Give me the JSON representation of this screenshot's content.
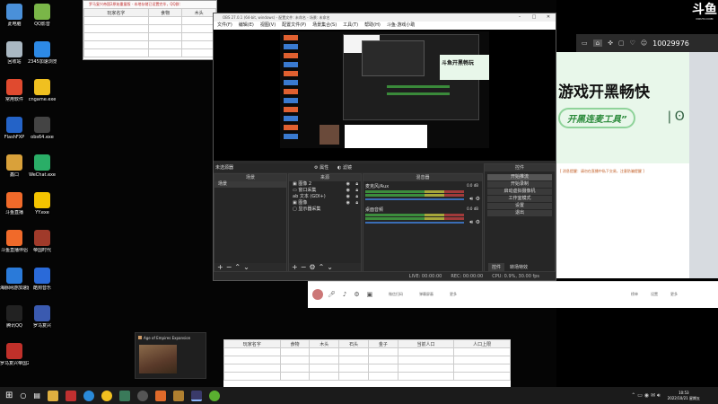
{
  "desktop": {
    "icons": [
      {
        "label": "此电脑",
        "color": "#4a90d9"
      },
      {
        "label": "QQ影音",
        "color": "#7ab648"
      },
      {
        "label": "回收站",
        "color": "#aab8c2"
      },
      {
        "label": "2345加速浏览器",
        "color": "#2d8ae6"
      },
      {
        "label": "常用软件",
        "color": "#e04a2f"
      },
      {
        "label": "cngame.exe",
        "color": "#f0c020"
      },
      {
        "label": "FlashFXP",
        "color": "#2463c7"
      },
      {
        "label": "obs64.exe",
        "color": "#444"
      },
      {
        "label": "鑫口",
        "color": "#d9a13a"
      },
      {
        "label": "WeChat.exe",
        "color": "#2aae67"
      },
      {
        "label": "斗鱼直播",
        "color": "#f06a2a"
      },
      {
        "label": "YY.exe",
        "color": "#f5c400"
      },
      {
        "label": "斗鱼直播伴侣",
        "color": "#f06a2a"
      },
      {
        "label": "帝国时代",
        "color": "#a03a2a"
      },
      {
        "label": "海豚网游加速器5.0",
        "color": "#2a7ad9"
      },
      {
        "label": "酷狗音乐",
        "color": "#2a6ad9"
      },
      {
        "label": "腾讯QQ",
        "color": "#222"
      },
      {
        "label": "罗马复兴",
        "color": "#3a5ab0"
      },
      {
        "label": "罗马复兴帝国2原始重量版",
        "color": "#c0302a"
      }
    ]
  },
  "spreadsheet_top": {
    "title": "罗马复兴帝国2原始重量版 · 本地存储已设置完毕，QQ群：",
    "headers": [
      "玩家名字",
      "食物",
      "木头"
    ]
  },
  "obs": {
    "title": "OBS 27.0.1 (64-bit, windows) - 配置文件: 未命名 - 场景: 未命名",
    "menu": [
      "文件(F)",
      "编辑(E)",
      "视图(V)",
      "配置文件(P)",
      "场景集合(S)",
      "工具(T)",
      "帮助(H)",
      "斗鱼·游戏小助"
    ],
    "preview_caption": "斗鱼开黑畅玩",
    "no_source": "未选源器",
    "props_label": "属性",
    "filter_label": "滤镜",
    "docks": {
      "scenes": "场景",
      "sources": "来源",
      "mixer": "混音器",
      "transitions": "转场",
      "controls": "控件"
    },
    "scene_items": [
      "场景"
    ],
    "source_items": [
      "图像 2",
      "窗口采集",
      "文本 (GDI+)",
      "图像",
      "显示器采集"
    ],
    "mixer_tracks": [
      {
        "name": "麦克风/Aux",
        "db": "0.0 dB"
      },
      {
        "name": "桌面音频",
        "db": "0.0 dB"
      }
    ],
    "control_buttons": [
      "开始推流",
      "开始录制",
      "启动虚拟摄像机",
      "工作室模式",
      "设置",
      "退出"
    ],
    "bottom_tabs": [
      "控件",
      "转场特效"
    ],
    "status": [
      "LIVE: 00:00:00",
      "REC: 00:00:00",
      "CPU: 0.9%, 30.00 fps"
    ]
  },
  "douyu": {
    "logo": "斗鱼",
    "logo_sub": "DOUYU.COM",
    "room_id": "10029976",
    "banner_line1": "游戏开黑畅快",
    "banner_line2": "开黑连麦工具”",
    "notice": "[ 消息提醒：请勿在直播中私下交易，注意防骗提醒 ]",
    "toolbar_labels": [
      "微信扫码",
      "弹幕屏蔽",
      "更多"
    ],
    "footer_labels": [
      "榜单",
      "设置",
      "更多"
    ]
  },
  "taskbar_popup": {
    "title": "Age of Empires Expansion"
  },
  "spreadsheet_bottom": {
    "headers": [
      "玩家名字",
      "食物",
      "木头",
      "石头",
      "金子",
      "当前人口",
      "人口上限"
    ]
  },
  "clock": {
    "time": "10:53",
    "date": "2022/10/21 星期五"
  }
}
